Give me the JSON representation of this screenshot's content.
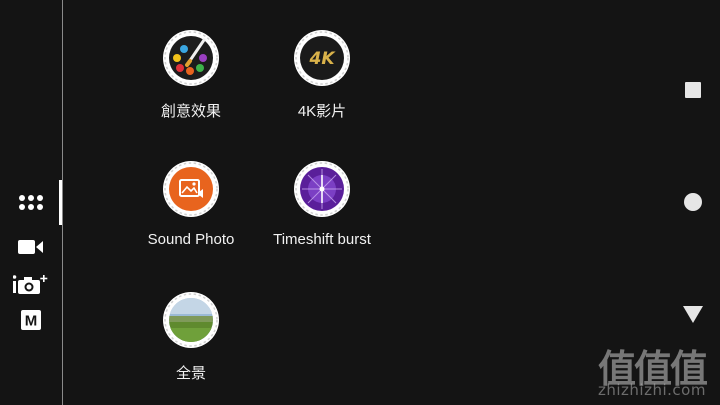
{
  "apps": [
    {
      "label": "創意效果",
      "icon": "palette-icon"
    },
    {
      "label": "4K影片",
      "icon": "4k-icon",
      "badge_text": "4K"
    },
    {
      "label": "Sound Photo",
      "icon": "sound-photo-icon"
    },
    {
      "label": "Timeshift burst",
      "icon": "timeshift-burst-icon"
    },
    {
      "label": "全景",
      "icon": "panorama-icon"
    }
  ],
  "sidebar": {
    "items": [
      {
        "icon": "app-grid-icon",
        "selected": true
      },
      {
        "icon": "video-camera-icon"
      },
      {
        "icon": "superior-auto-camera-icon"
      },
      {
        "icon": "manual-mode-icon",
        "text": "M"
      }
    ]
  },
  "nav": [
    {
      "icon": "recents-square-icon"
    },
    {
      "icon": "home-circle-icon"
    },
    {
      "icon": "back-triangle-icon"
    }
  ],
  "watermark": {
    "logo": "值值值",
    "url": "zhizhizhi.com"
  },
  "colors": {
    "background": "#141414",
    "accent_orange": "#e8641e",
    "accent_purple": "#5a1f9a"
  }
}
